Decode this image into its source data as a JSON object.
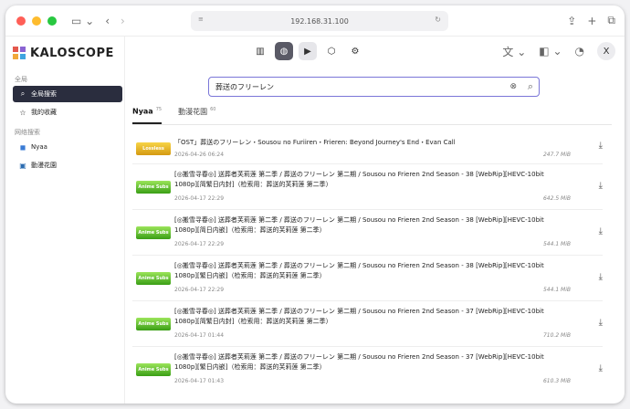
{
  "browser": {
    "address": "192.168.31.100"
  },
  "app": {
    "logo_text": "KALOSCOPE",
    "sections": [
      {
        "label": "全局",
        "items": [
          {
            "label": "全局搜索",
            "icon": "search-icon",
            "active": true
          },
          {
            "label": "我的收藏",
            "icon": "star-icon",
            "active": false
          }
        ]
      },
      {
        "label": "网络搜索",
        "items": [
          {
            "label": "Nyaa",
            "icon": "nyaa-icon",
            "active": false
          },
          {
            "label": "動漫花園",
            "icon": "dmhy-icon",
            "active": false
          }
        ]
      }
    ],
    "avatar_initial": "X"
  },
  "search": {
    "value": "葬送のフリーレン"
  },
  "tabs": [
    {
      "label": "Nyaa",
      "count": "75",
      "active": true
    },
    {
      "label": "動漫花園",
      "count": "60",
      "active": false
    }
  ],
  "results": [
    {
      "thumb": "gold",
      "thumb_text": "Lossless Audio",
      "title": "「OST」葬送のフリーレン・Sousou no Furiiren・Frieren: Beyond Journey's End・Evan Call",
      "date": "2026-04-26 06:24",
      "size": "247.7 MiB"
    },
    {
      "thumb": "green",
      "thumb_text": "Anime Subs",
      "title": "[◎搬雪寻春◎] 送葬者芙莉莲 第二季 / 葬送のフリーレン 第二期 / Sousou no Frieren 2nd Season - 38 [WebRip][HEVC-10bit 1080p][简繁日内封]（检索用：葬送的芙莉莲 第二季）",
      "date": "2026-04-17 22:29",
      "size": "642.5 MiB"
    },
    {
      "thumb": "green",
      "thumb_text": "Anime Subs",
      "title": "[◎搬雪寻春◎] 送葬者芙莉莲 第二季 / 葬送のフリーレン 第二期 / Sousou no Frieren 2nd Season - 38 [WebRip][HEVC-10bit 1080p][简日内嵌]（检索用：葬送的芙莉莲 第二季）",
      "date": "2026-04-17 22:29",
      "size": "544.1 MiB"
    },
    {
      "thumb": "green",
      "thumb_text": "Anime Subs",
      "title": "[◎搬雪寻春◎] 送葬者芙莉莲 第二季 / 葬送のフリーレン 第二期 / Sousou no Frieren 2nd Season - 38 [WebRip][HEVC-10bit 1080p][繁日内嵌]（检索用：葬送的芙莉莲 第二季）",
      "date": "2026-04-17 22:29",
      "size": "544.1 MiB"
    },
    {
      "thumb": "green",
      "thumb_text": "Anime Subs",
      "title": "[◎搬雪寻春◎] 送葬者芙莉莲 第二季 / 葬送のフリーレン 第二期 / Sousou no Frieren 2nd Season - 37 [WebRip][HEVC-10bit 1080p][简繁日内封]（检索用：葬送的芙莉莲 第二季）",
      "date": "2026-04-17 01:44",
      "size": "710.2 MiB"
    },
    {
      "thumb": "green",
      "thumb_text": "Anime Subs",
      "title": "[◎搬雪寻春◎] 送葬者芙莉莲 第二季 / 葬送のフリーレン 第二期 / Sousou no Frieren 2nd Season - 37 [WebRip][HEVC-10bit 1080p][繁日内嵌]（检索用：葬送的芙莉莲 第二季）",
      "date": "2026-04-17 01:43",
      "size": "610.3 MiB"
    }
  ]
}
